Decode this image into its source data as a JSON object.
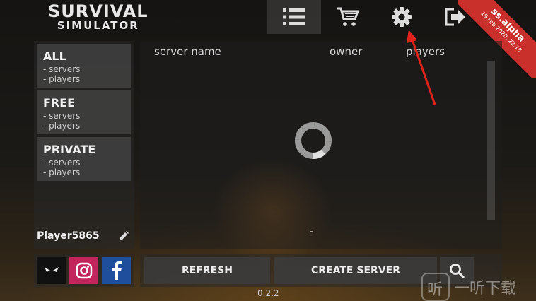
{
  "logo": {
    "line1": "SURVIVAL",
    "line2": "SIMULATOR"
  },
  "topnav": [
    {
      "icon": "list-icon",
      "active": true
    },
    {
      "icon": "cart-icon",
      "active": false
    },
    {
      "icon": "gear-icon",
      "active": false
    },
    {
      "icon": "exit-icon",
      "active": false
    }
  ],
  "ribbon": {
    "label": "ss.alpha",
    "date": "19 Feb 2020, 22:18"
  },
  "filters": [
    {
      "name": "ALL",
      "servers": "- servers",
      "players": "- players"
    },
    {
      "name": "FREE",
      "servers": "- servers",
      "players": "- players"
    },
    {
      "name": "PRIVATE",
      "servers": "- servers",
      "players": "- players"
    }
  ],
  "player": {
    "name": "Player5865"
  },
  "table": {
    "columns": [
      "server name",
      "owner",
      "players"
    ],
    "status": "-"
  },
  "social": [
    {
      "icon": "alien-icon",
      "color": "#111111"
    },
    {
      "icon": "instagram-icon",
      "color": "#c2255c"
    },
    {
      "icon": "facebook-icon",
      "color": "#1f4e9c"
    }
  ],
  "actions": {
    "refresh": "REFRESH",
    "create": "CREATE SERVER"
  },
  "version": "0.2.2",
  "watermark": {
    "glyph": "听",
    "text": "一听下载"
  },
  "colors": {
    "accent": "#c9302c",
    "arrow": "#e2231a"
  }
}
